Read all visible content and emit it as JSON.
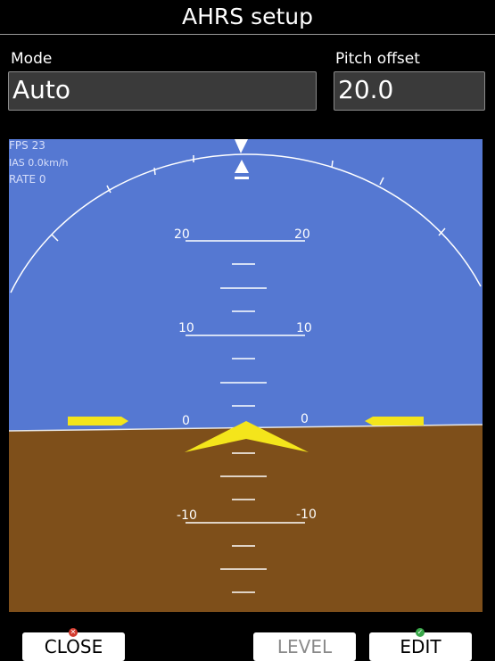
{
  "title": "AHRS setup",
  "mode": {
    "label": "Mode",
    "value": "Auto"
  },
  "pitch_offset": {
    "label": "Pitch offset",
    "value": "20.0"
  },
  "debug": {
    "fps": "FPS 23",
    "ias": "IAS 0.0km/h",
    "rate": "RATE 0"
  },
  "pitch_ladder": {
    "major_labels": [
      "20",
      "10",
      "0",
      "-10"
    ]
  },
  "colors": {
    "sky": "#5578d2",
    "ground": "#7e4f1a",
    "aircraft_symbol": "#f4e51b",
    "close_icon": "#d33b2f",
    "edit_icon": "#3aa84a"
  },
  "buttons": {
    "close": "CLOSE",
    "level": "LEVEL",
    "edit": "EDIT"
  }
}
